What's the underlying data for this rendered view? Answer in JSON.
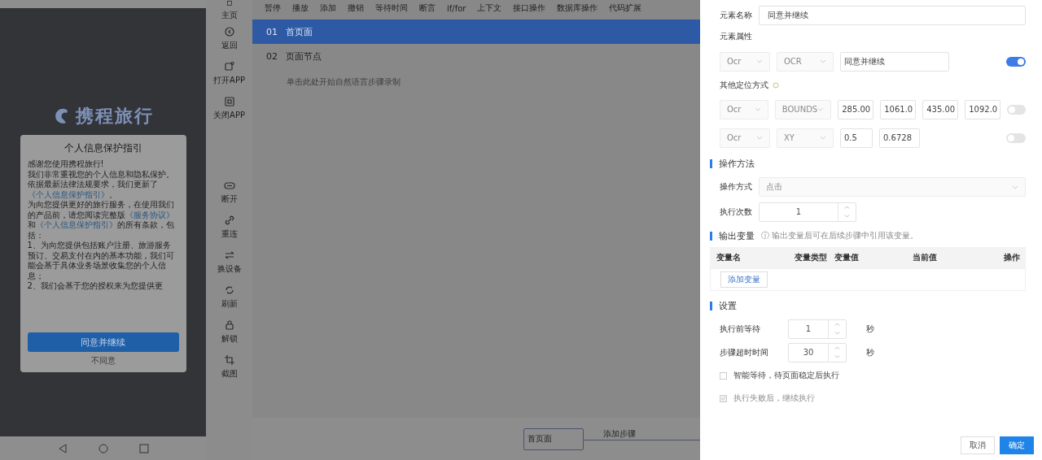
{
  "phone": {
    "logo": "携程旅行",
    "dialog": {
      "title": "个人信息保护指引",
      "paragraphs": [
        [
          {
            "text": "感谢您使用携程旅行!",
            "link": false
          }
        ],
        [
          {
            "text": "我们非常重视您的个人信息和隐私保护。依据最新法律法规要求，我们更新了",
            "link": false
          },
          {
            "text": "《个人信息保护指引》",
            "link": true
          },
          {
            "text": "。",
            "link": false
          }
        ],
        [
          {
            "text": "为向您提供更好的旅行服务，在使用我们的产品前，请您阅读完整版",
            "link": false
          },
          {
            "text": "《服务协议》",
            "link": true
          },
          {
            "text": "和",
            "link": false
          },
          {
            "text": "《个人信息保护指引》",
            "link": true
          },
          {
            "text": "的所有条款，包括：",
            "link": false
          }
        ],
        [
          {
            "text": "1、为向您提供包括账户注册、旅游服务预订、交易支付在内的基本功能，我们可能会基于具体业务场景收集您的个人信息；",
            "link": false
          }
        ],
        [
          {
            "text": "2、我们会基于您的授权来为您提供更",
            "link": false
          }
        ]
      ],
      "agree": "同意并继续",
      "disagree": "不同意"
    }
  },
  "tools": [
    {
      "label": "主页",
      "kind": "home"
    },
    {
      "label": "返回",
      "kind": "back"
    },
    {
      "label": "打开APP",
      "kind": "open"
    },
    {
      "label": "关闭APP",
      "kind": "close"
    },
    {
      "label": "断开",
      "kind": "disconnect"
    },
    {
      "label": "重连",
      "kind": "link"
    },
    {
      "label": "换设备",
      "kind": "swap"
    },
    {
      "label": "刷新",
      "kind": "refresh"
    },
    {
      "label": "解锁",
      "kind": "lock"
    },
    {
      "label": "截图",
      "kind": "crop"
    }
  ],
  "toolbar": [
    "暂停",
    "播放",
    "添加",
    "撤销",
    "等待时间",
    "断言",
    "if/for",
    "上下文",
    "接口操作",
    "数据库操作",
    "代码扩展"
  ],
  "steps": [
    {
      "number": "01",
      "label": "首页面",
      "selected": true
    },
    {
      "number": "02",
      "label": "页面节点",
      "selected": false
    }
  ],
  "step_hint": "单击此处开始自然语言步骤录制",
  "flow": {
    "node": "首页面",
    "edge_label": "添加步骤"
  },
  "drawer": {
    "name_label": "元素名称",
    "name_value": "同意并继续",
    "attr_label": "元素属性",
    "attr_row": {
      "selects": [
        "Ocr",
        "OCR"
      ],
      "values": [
        "同意并继续"
      ],
      "on": true
    },
    "other_label": "其他定位方式",
    "other_rows": [
      {
        "selects": [
          "Ocr",
          "BOUNDS"
        ],
        "values": [
          "285.00",
          "1061.0",
          "435.00",
          "1092.0"
        ],
        "on": false
      },
      {
        "selects": [
          "Ocr",
          "XY"
        ],
        "values": [
          "0.5",
          "0.6728"
        ],
        "on": false
      }
    ],
    "method_title": "操作方法",
    "method_label": "操作方式",
    "method_value": "点击",
    "count_label": "执行次数",
    "count_value": "1",
    "output_title": "输出变量",
    "output_hint": "ⓘ 输出变量后可在后续步骤中引用该变量。",
    "columns": [
      "变量名",
      "变量类型",
      "变量值",
      "当前值",
      "操作"
    ],
    "add_variable": "添加变量",
    "settings_title": "设置",
    "timings": [
      {
        "label": "执行前等待",
        "value": "1",
        "unit": "秒"
      },
      {
        "label": "步骤超时时间",
        "value": "30",
        "unit": "秒"
      }
    ],
    "options": [
      {
        "label": "智能等待，待页面稳定后执行",
        "checked": false,
        "disabled": false
      },
      {
        "label": "执行失败后，继续执行",
        "checked": true,
        "disabled": true
      }
    ],
    "cancel": "取消",
    "confirm": "确定"
  }
}
